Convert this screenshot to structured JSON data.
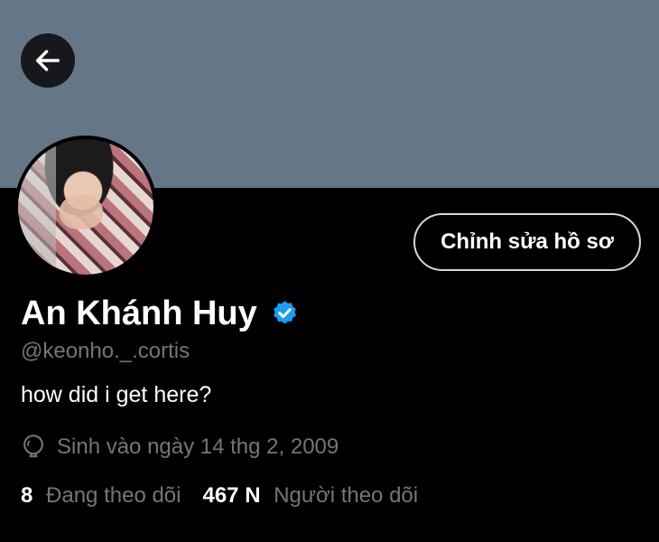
{
  "header": {
    "back_icon": "arrow-left-icon",
    "banner_color": "#657786"
  },
  "profile": {
    "edit_button_label": "Chỉnh sửa hồ sơ",
    "name": "An Khánh Huy",
    "verified_icon": "verified-badge-icon",
    "verified_color": "#1d9bf0",
    "handle": "@keonho._.cortis",
    "bio": "how did i get here?",
    "birth_icon": "balloon-icon",
    "birth_text": "Sinh vào ngày 14 thg 2, 2009"
  },
  "stats": {
    "following_count": "8",
    "following_label": "Đang theo dõi",
    "followers_count": "467 N",
    "followers_label": "Người theo dõi"
  }
}
